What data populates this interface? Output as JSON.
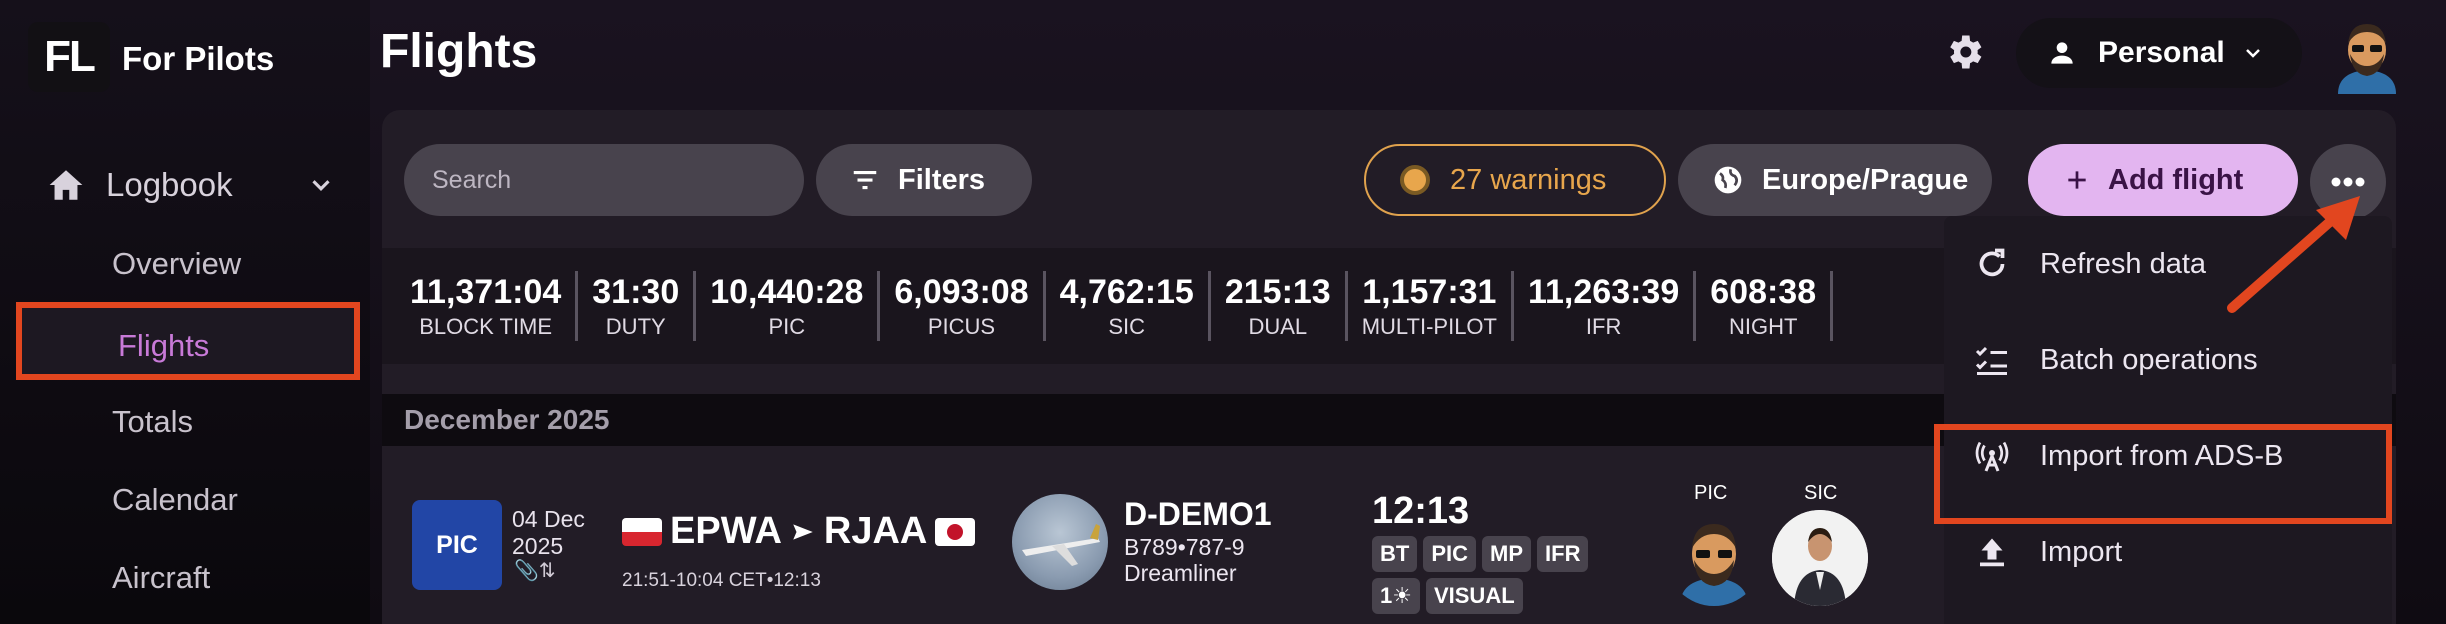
{
  "app": {
    "logo": "FL",
    "name": "For Pilots"
  },
  "sidebar": {
    "logbook": "Logbook",
    "items": [
      "Overview",
      "Flights",
      "Totals",
      "Calendar",
      "Aircraft"
    ]
  },
  "header": {
    "title": "Flights",
    "profile": "Personal"
  },
  "toolbar": {
    "search_placeholder": "Search",
    "filters": "Filters",
    "warnings": "27 warnings",
    "timezone": "Europe/Prague",
    "add_flight": "Add flight"
  },
  "stats": [
    {
      "value": "11,371:04",
      "label": "BLOCK TIME"
    },
    {
      "value": "31:30",
      "label": "DUTY"
    },
    {
      "value": "10,440:28",
      "label": "PIC"
    },
    {
      "value": "6,093:08",
      "label": "PICUS"
    },
    {
      "value": "4,762:15",
      "label": "SIC"
    },
    {
      "value": "215:13",
      "label": "DUAL"
    },
    {
      "value": "1,157:31",
      "label": "MULTI-PILOT"
    },
    {
      "value": "11,263:39",
      "label": "IFR"
    },
    {
      "value": "608:38",
      "label": "NIGHT"
    }
  ],
  "month": "December 2025",
  "flight": {
    "role": "PIC",
    "date_line1": "04 Dec",
    "date_line2": "2025",
    "from": "EPWA",
    "to": "RJAA",
    "times": "21:51-10:04 CET•12:13",
    "registration": "D-DEMO1",
    "type_line1": "B789•787-9",
    "type_line2": "Dreamliner",
    "block": "12:13",
    "tags": [
      "BT",
      "PIC",
      "MP",
      "IFR",
      "1☀",
      "VISUAL"
    ],
    "crew_pic": "PIC",
    "crew_sic": "SIC"
  },
  "menu": {
    "items": [
      {
        "label": "Refresh data",
        "icon": "refresh-icon"
      },
      {
        "label": "Batch operations",
        "icon": "checklist-icon"
      },
      {
        "label": "Import from ADS-B",
        "icon": "antenna-icon"
      },
      {
        "label": "Import",
        "icon": "upload-icon"
      }
    ]
  },
  "colors": {
    "accent": "#e3b5f0",
    "highlight": "#e2461f",
    "warning": "#e8a64c",
    "pic_badge": "#2246a6"
  }
}
